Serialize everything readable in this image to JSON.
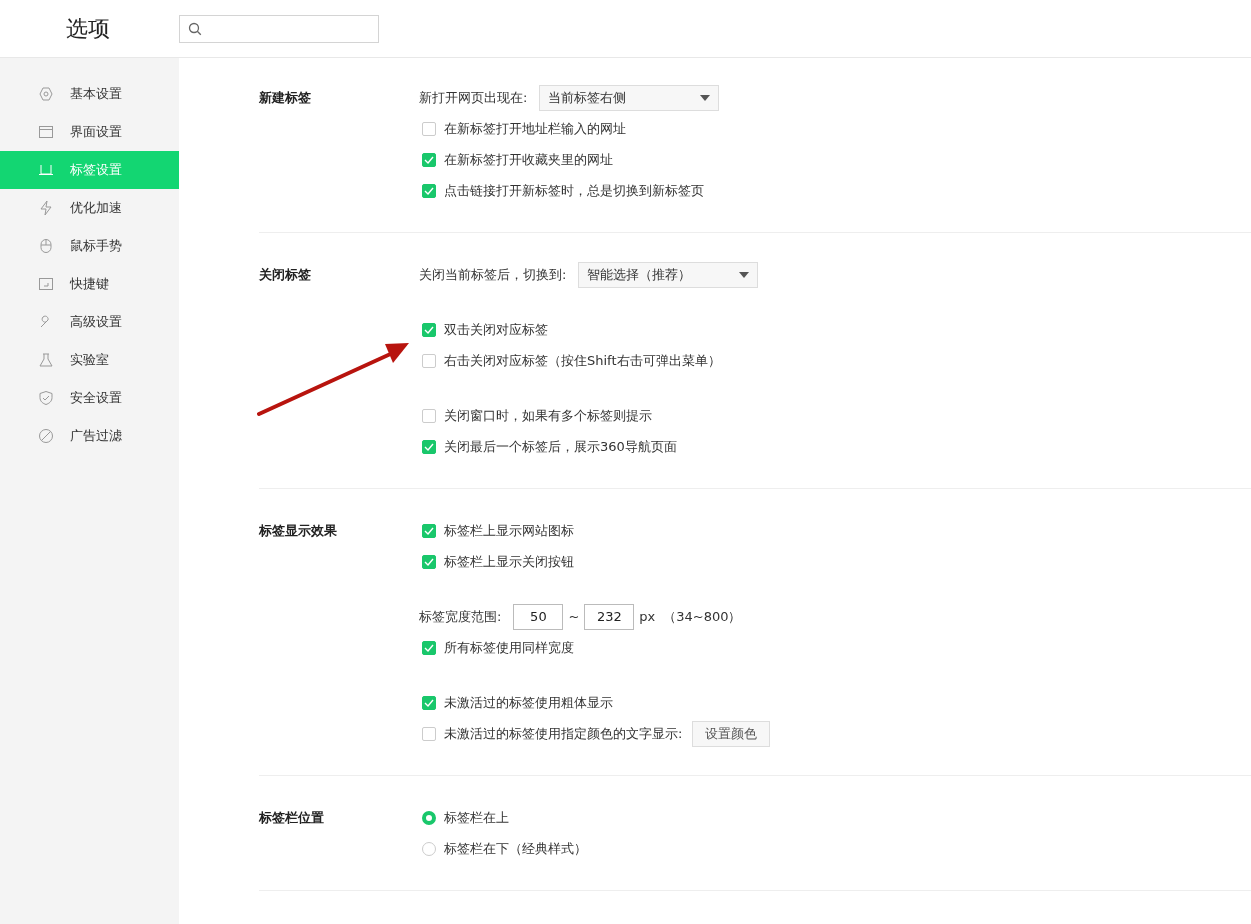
{
  "header": {
    "title": "选项"
  },
  "sidebar": {
    "items": [
      {
        "label": "基本设置",
        "selected": false
      },
      {
        "label": "界面设置",
        "selected": false
      },
      {
        "label": "标签设置",
        "selected": true
      },
      {
        "label": "优化加速",
        "selected": false
      },
      {
        "label": "鼠标手势",
        "selected": false
      },
      {
        "label": "快捷键",
        "selected": false
      },
      {
        "label": "高级设置",
        "selected": false
      },
      {
        "label": "实验室",
        "selected": false
      },
      {
        "label": "安全设置",
        "selected": false
      },
      {
        "label": "广告过滤",
        "selected": false
      }
    ]
  },
  "sections": [
    {
      "heading": "新建标签",
      "groups": [
        [
          {
            "kind": "select",
            "label": "新打开网页出现在:",
            "value": "当前标签右侧"
          },
          {
            "kind": "checkbox",
            "label": "在新标签打开地址栏输入的网址",
            "checked": false
          },
          {
            "kind": "checkbox",
            "label": "在新标签打开收藏夹里的网址",
            "checked": true
          },
          {
            "kind": "checkbox",
            "label": "点击链接打开新标签时，总是切换到新标签页",
            "checked": true
          }
        ]
      ]
    },
    {
      "heading": "关闭标签",
      "groups": [
        [
          {
            "kind": "select",
            "label": "关闭当前标签后，切换到:",
            "value": "智能选择（推荐）"
          }
        ],
        [
          {
            "kind": "checkbox",
            "label": "双击关闭对应标签",
            "checked": true
          },
          {
            "kind": "checkbox",
            "label": "右击关闭对应标签（按住Shift右击可弹出菜单）",
            "checked": false
          }
        ],
        [
          {
            "kind": "checkbox",
            "label": "关闭窗口时，如果有多个标签则提示",
            "checked": false
          },
          {
            "kind": "checkbox",
            "label": "关闭最后一个标签后，展示360导航页面",
            "checked": true
          }
        ]
      ]
    },
    {
      "heading": "标签显示效果",
      "groups": [
        [
          {
            "kind": "checkbox",
            "label": "标签栏上显示网站图标",
            "checked": true
          },
          {
            "kind": "checkbox",
            "label": "标签栏上显示关闭按钮",
            "checked": true
          }
        ],
        [
          {
            "kind": "range",
            "label": "标签宽度范围:",
            "min": "50",
            "separator": "~",
            "max": "232",
            "unit": "px",
            "hint": "（34~800）"
          },
          {
            "kind": "checkbox",
            "label": "所有标签使用同样宽度",
            "checked": true
          }
        ],
        [
          {
            "kind": "checkbox",
            "label": "未激活过的标签使用粗体显示",
            "checked": true
          },
          {
            "kind": "checkbox",
            "label": "未激活过的标签使用指定颜色的文字显示:",
            "checked": false,
            "button": "设置颜色"
          }
        ]
      ]
    },
    {
      "heading": "标签栏位置",
      "groups": [
        [
          {
            "kind": "radio",
            "label": "标签栏在上",
            "selected": true
          },
          {
            "kind": "radio",
            "label": "标签栏在下（经典样式）",
            "selected": false
          }
        ]
      ]
    }
  ]
}
